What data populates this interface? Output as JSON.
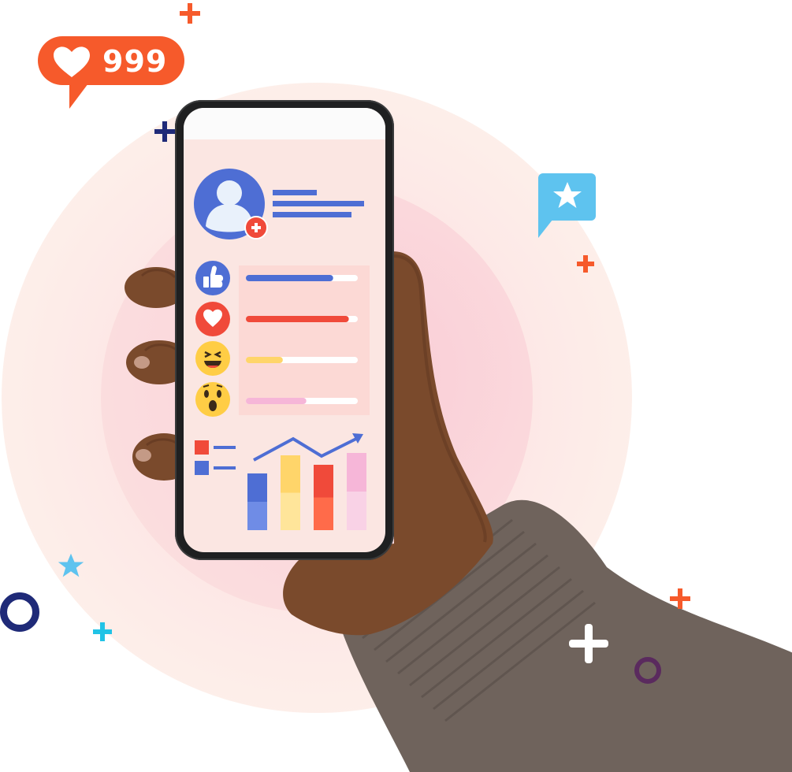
{
  "notification": {
    "count": "999",
    "icon": "heart-icon"
  },
  "reactions": [
    {
      "name": "like",
      "icon": "thumbs-up-icon",
      "level": 0.78,
      "color": "#4e6ed4"
    },
    {
      "name": "love",
      "icon": "heart-icon",
      "level": 0.92,
      "color": "#f04a3a"
    },
    {
      "name": "haha",
      "icon": "laughing-face-icon",
      "level": 0.33,
      "color": "#ffd56a"
    },
    {
      "name": "wow",
      "icon": "surprised-face-icon",
      "level": 0.54,
      "color": "#f6b6d8"
    }
  ],
  "bars": [
    {
      "color_top": "#4e6ed4",
      "color_bottom": "#6f8ce6",
      "level": 0.72
    },
    {
      "color_top": "#ffd56a",
      "color_bottom": "#ffe59a",
      "level": 0.95
    },
    {
      "color_top": "#f04a3a",
      "color_bottom": "#ff6b4a",
      "level": 0.83
    },
    {
      "color_top": "#f6b6d8",
      "color_bottom": "#f9d2e6",
      "level": 0.98
    }
  ],
  "colors": {
    "accent_orange": "#f65a2b",
    "accent_blue": "#4e6ed4",
    "accent_cyan": "#5ec3ef",
    "navy": "#1f2a78",
    "purple": "#5a2a5e"
  }
}
